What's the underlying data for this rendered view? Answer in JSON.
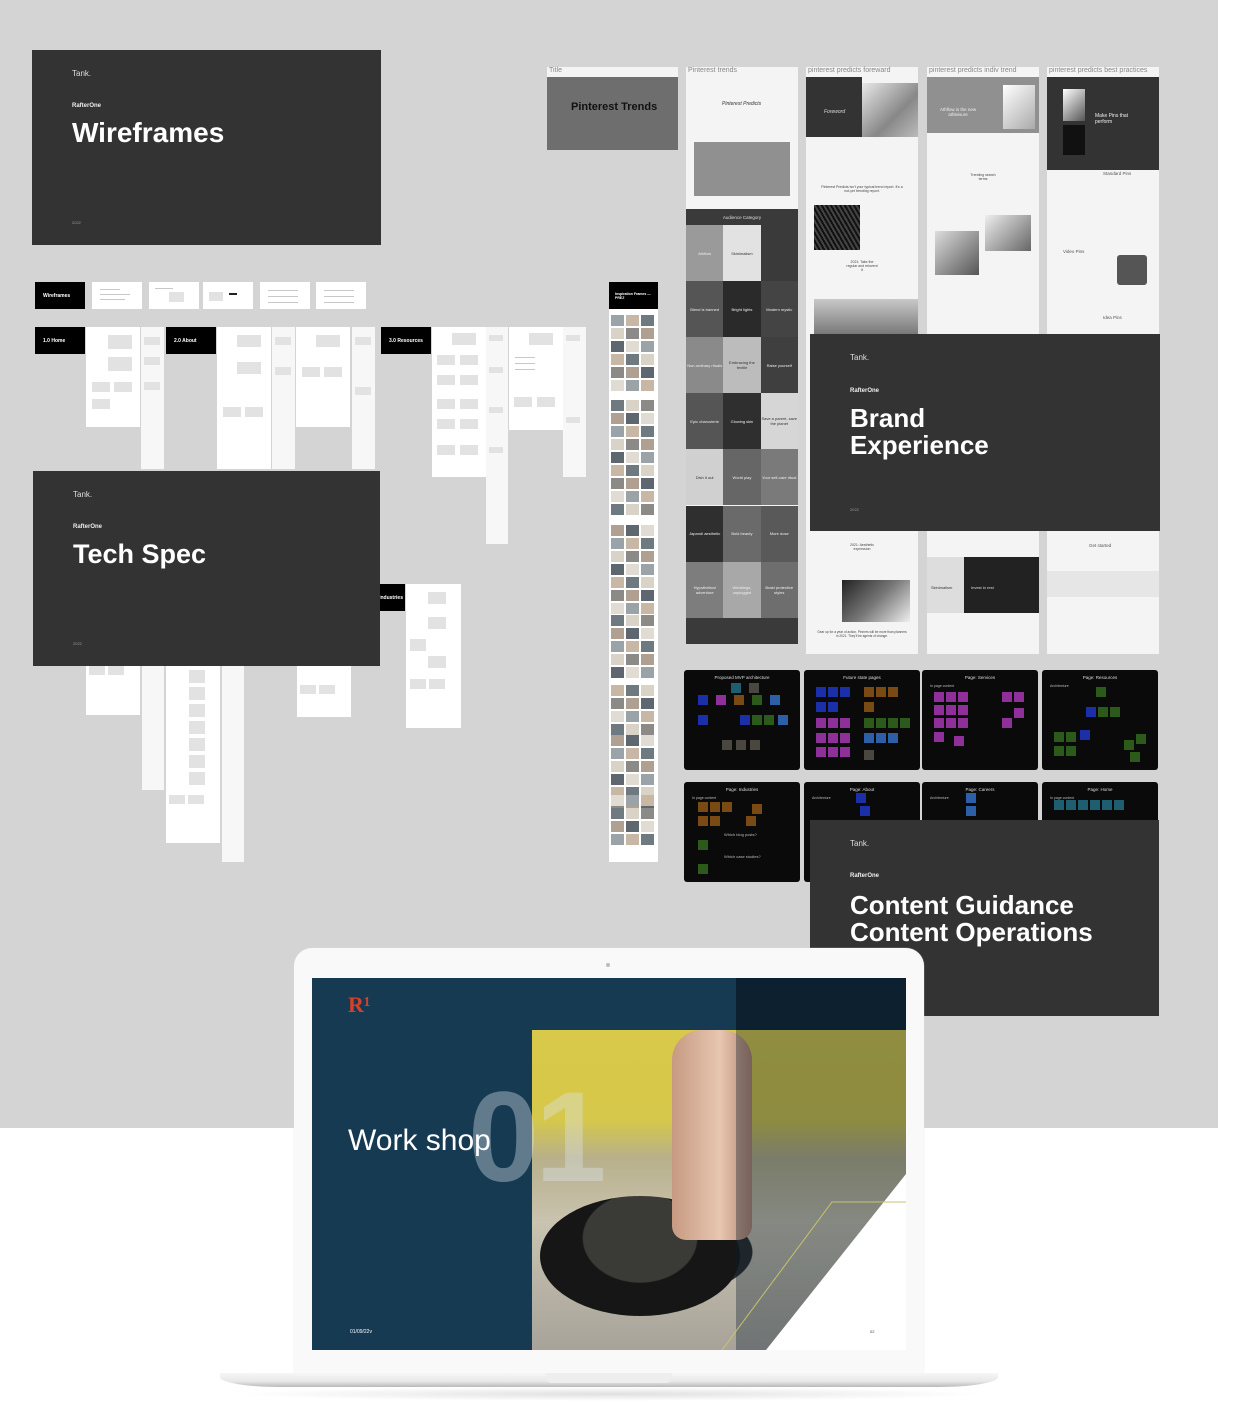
{
  "canvas": {
    "background": "#d4d4d4"
  },
  "covers": {
    "wireframes": {
      "brand": "Tank.",
      "client": "RafterOne",
      "title": "Wireframes",
      "year": "2022"
    },
    "tech_spec": {
      "brand": "Tank.",
      "client": "RafterOne",
      "title": "Tech Spec",
      "year": "2022"
    },
    "brand_experience": {
      "brand": "Tank.",
      "client": "RafterOne",
      "title": "Brand\nExperience",
      "year": "2022"
    },
    "content": {
      "brand": "Tank.",
      "client": "RafterOne",
      "title": "Content Guidance\nContent Operations"
    }
  },
  "wireframe_sections": {
    "intro": "Wireframes",
    "home": "1.0 Home",
    "about": "2.0 About",
    "resources": "3.0 Resources",
    "industries": "Industries",
    "inspiration": "Inspiration Frames — PREZ"
  },
  "pinterest": {
    "frames": [
      {
        "label": "Title",
        "heading": "Pinterest Trends"
      },
      {
        "label": "Pinterest trends",
        "heading": "Pinterest Predicts"
      },
      {
        "label": "pinterest predicts foreward",
        "heading": "Foreword"
      },
      {
        "label": "pinterest predicts indiv trend",
        "heading": "Athflow is the new athleisure"
      },
      {
        "label": "pinterest predicts best practices",
        "heading": "Make Pins that perform"
      }
    ],
    "audience_category": "Audience   Category",
    "grid": [
      "Athflow",
      "Skinimalism",
      "",
      "Blend is banned",
      "Bright lights",
      "Modern mystic",
      "Non-ordinary rituals",
      "Embracing the textile",
      "Raise yourself",
      "Epic charcuterie",
      "Glowing skin",
      "Save a parent, save the planet",
      "Dish it out",
      "World play",
      "Your self-care ritual",
      "Japandi aesthetic",
      "Bold beauty",
      "More dose",
      "Hypothetical adventure",
      "Weddings, unplugged",
      "Braid protective styles"
    ],
    "texts": {
      "predicts_line": "Pinterest Predicts isn't your typical trend report. It's a not-yet trending report.",
      "take_the_regular": "2021: Take the regular and reinvent it",
      "aesthetic_expression": "2021: Aesthetic expression",
      "gear_up": "Gear up for a year of action. Pinners will be more than planners in 2021. They'll be agents of change.",
      "trending_search_terms": "Trending search terms",
      "standard_pins": "Standard Pins",
      "video_pins": "Video Pins",
      "idea_pins": "Idea Pins",
      "get_started": "Get started",
      "skinimalism": "Skinimalism",
      "invest_in_rest": "Invest in rest"
    }
  },
  "architecture_boards": [
    {
      "title": "Proposed MVP architecture"
    },
    {
      "title": "Future state pages"
    },
    {
      "title": "Page: Services",
      "sub": "In page content"
    },
    {
      "title": "Page: Resources",
      "sub": "Architecture"
    },
    {
      "title": "Page: Industries",
      "sub": "In page content",
      "q1": "Which blog posts?",
      "q2": "Which case studies?"
    },
    {
      "title": "Page: About",
      "sub": "Architecture"
    },
    {
      "title": "Page: Careers",
      "sub": "Architecture"
    },
    {
      "title": "Page: Home",
      "sub": "In page content"
    }
  ],
  "sticky_colors": {
    "blue": "#1a2fa8",
    "purple": "#8e2f9a",
    "brown": "#7a4a14",
    "green": "#2c5a1a",
    "teal": "#1f5d70",
    "gray": "#4a4640",
    "lightblue": "#2d5ea8"
  },
  "laptop_slide": {
    "logo": "R¹",
    "title": "Work shop",
    "number": "01",
    "date": "01/09/22v",
    "page": "02",
    "colors": {
      "navy": "#163a52",
      "logo_red": "#d6402a",
      "accent_line": "#c9c46a"
    }
  }
}
